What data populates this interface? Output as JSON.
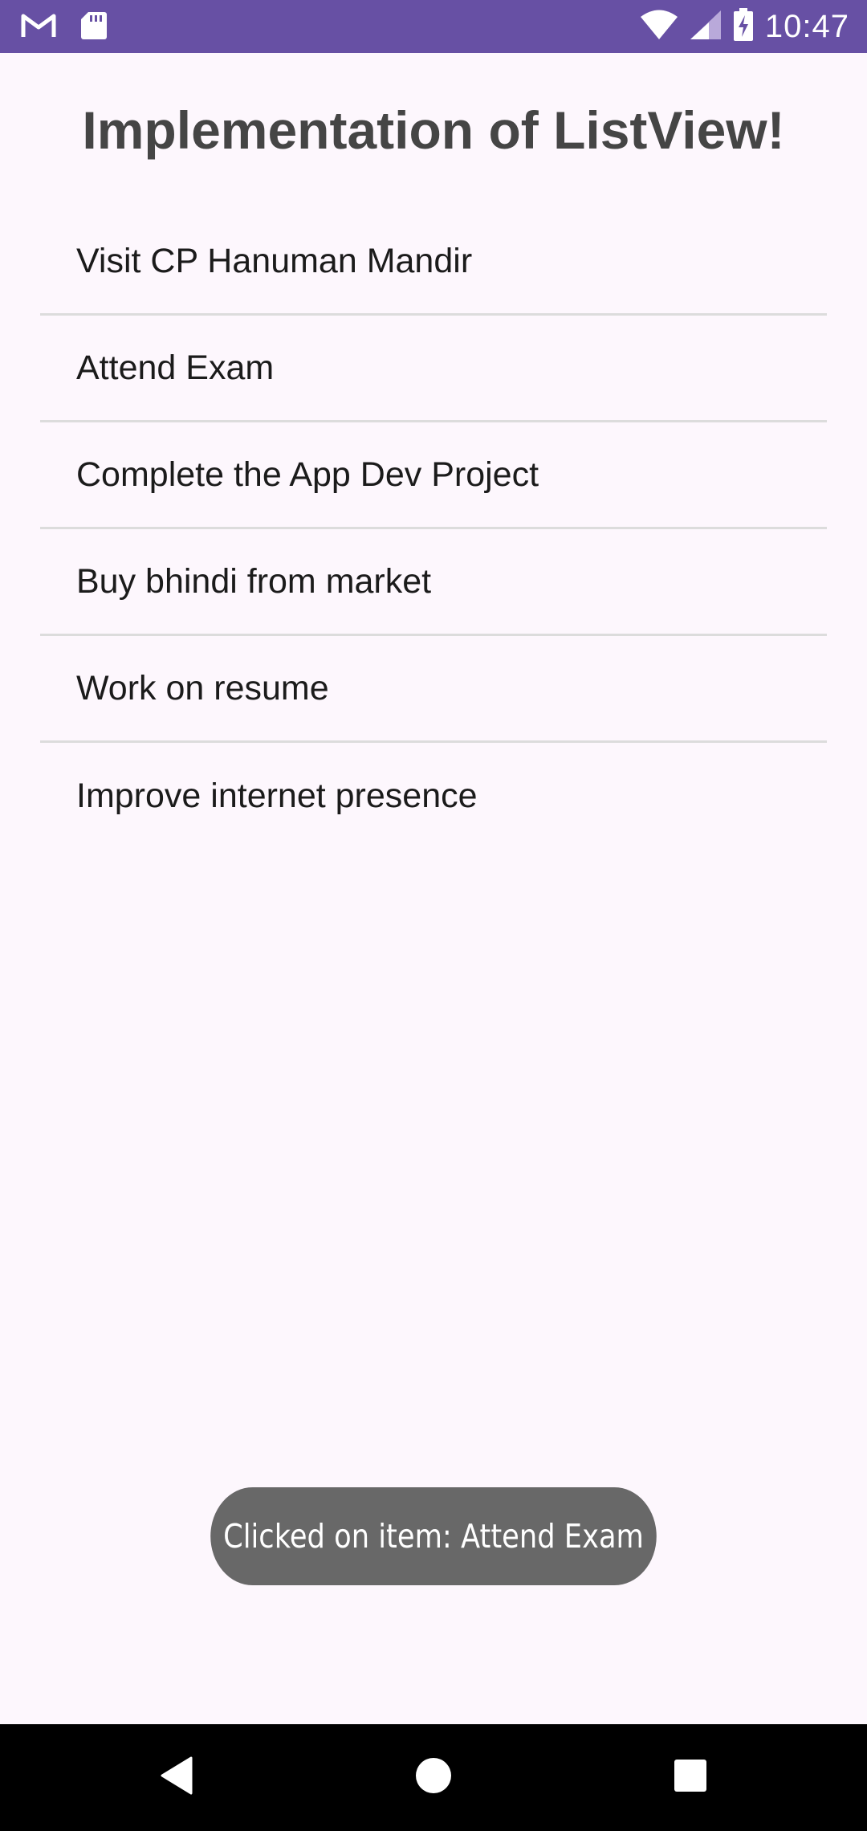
{
  "status_bar": {
    "time": "10:47",
    "left_icons": [
      "gmail-icon",
      "sd-card-icon"
    ],
    "right_icons": [
      "wifi-icon",
      "signal-icon",
      "battery-charging-icon"
    ]
  },
  "app": {
    "title": "Implementation of ListView!",
    "items": [
      {
        "label": "Visit CP Hanuman Mandir"
      },
      {
        "label": "Attend Exam"
      },
      {
        "label": "Complete the App Dev Project"
      },
      {
        "label": "Buy bhindi from market"
      },
      {
        "label": "Work on resume"
      },
      {
        "label": "Improve internet presence"
      }
    ]
  },
  "toast": {
    "message": "Clicked on item: Attend Exam"
  },
  "nav_bar": {
    "buttons": [
      "back-icon",
      "home-icon",
      "recents-icon"
    ]
  },
  "colors": {
    "status_bar": "#6750A4",
    "background": "#FDF7FD",
    "title": "#454545",
    "toast_bg": "#686868",
    "nav_bar": "#000000"
  }
}
